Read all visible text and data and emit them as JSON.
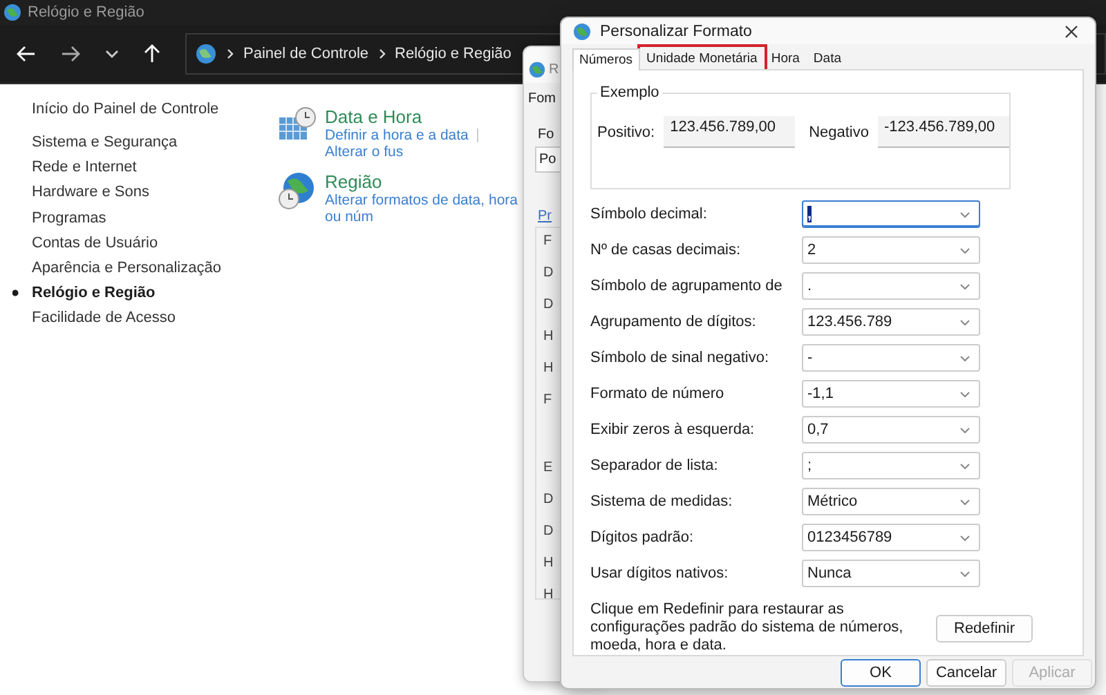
{
  "explorer": {
    "title": "Relógio e Região",
    "breadcrumb": [
      "Painel de Controle",
      "Relógio e Região"
    ],
    "sidebar": {
      "home": "Início do Painel de Controle",
      "items": [
        {
          "label": "Sistema e Segurança",
          "selected": false
        },
        {
          "label": "Rede e Internet",
          "selected": false
        },
        {
          "label": "Hardware e Sons",
          "selected": false
        },
        {
          "label": "Programas",
          "selected": false
        },
        {
          "label": "Contas de Usuário",
          "selected": false
        },
        {
          "label": "Aparência e Personalização",
          "selected": false
        },
        {
          "label": "Relógio e Região",
          "selected": true
        },
        {
          "label": "Facilidade de Acesso",
          "selected": false
        }
      ]
    },
    "categories": [
      {
        "kind": "calendar",
        "title": "Data e Hora",
        "links": [
          "Definir a hora e a data",
          "Alterar o fus"
        ]
      },
      {
        "kind": "globe",
        "title": "Região",
        "links": [
          "Alterar formatos de data, hora ou núm"
        ]
      }
    ]
  },
  "region_dialog": {
    "title": "R",
    "tab": "Fom",
    "field_label": "Fo",
    "field_value": "Po",
    "link": "Pr",
    "group_letters": [
      "F",
      "D",
      "D",
      "H",
      "H",
      "F",
      "E",
      "D",
      "D",
      "H",
      "H"
    ]
  },
  "dialog": {
    "title": "Personalizar Formato",
    "tabs": [
      {
        "label": "Números",
        "selected": true,
        "highlighted": false
      },
      {
        "label": "Unidade Monetária",
        "selected": false,
        "highlighted": true
      },
      {
        "label": "Hora",
        "selected": false,
        "highlighted": false
      },
      {
        "label": "Data",
        "selected": false,
        "highlighted": false
      }
    ],
    "example": {
      "legend": "Exemplo",
      "positive_label": "Positivo:",
      "positive_value": "123.456.789,00",
      "negative_label": "Negativo",
      "negative_value": "-123.456.789,00"
    },
    "settings": [
      {
        "label": "Símbolo decimal:",
        "value": ",",
        "focused": true
      },
      {
        "label": "Nº de casas decimais:",
        "value": "2",
        "focused": false
      },
      {
        "label": "Símbolo de agrupamento de",
        "value": ".",
        "focused": false
      },
      {
        "label": "Agrupamento de dígitos:",
        "value": "123.456.789",
        "focused": false
      },
      {
        "label": "Símbolo de sinal negativo:",
        "value": "-",
        "focused": false
      },
      {
        "label": "Formato de número",
        "value": "-1,1",
        "focused": false
      },
      {
        "label": "Exibir zeros à esquerda:",
        "value": "0,7",
        "focused": false
      },
      {
        "label": "Separador de lista:",
        "value": ";",
        "focused": false
      },
      {
        "label": "Sistema de medidas:",
        "value": "Métrico",
        "focused": false
      },
      {
        "label": "Dígitos padrão:",
        "value": "0123456789",
        "focused": false
      },
      {
        "label": "Usar dígitos nativos:",
        "value": "Nunca",
        "focused": false
      }
    ],
    "reset_note": "Clique em Redefinir para restaurar as configurações padrão do sistema de números, moeda, hora e data.",
    "reset_button": "Redefinir",
    "buttons": [
      {
        "label": "OK",
        "disabled": false,
        "default": true
      },
      {
        "label": "Cancelar",
        "disabled": false,
        "default": false
      },
      {
        "label": "Aplicar",
        "disabled": true,
        "default": false
      }
    ]
  }
}
